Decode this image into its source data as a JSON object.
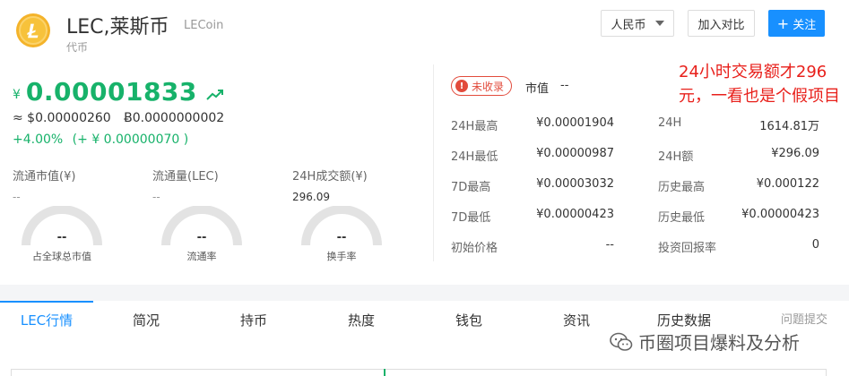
{
  "header": {
    "title": "LEC,莱斯币",
    "subtitle": "LECoin",
    "type": "代币",
    "logo_icon": "litecoin-logo-icon",
    "currency_select": "人民币",
    "compare_label": "加入对比",
    "follow_label": "关注",
    "follow_icon": "+"
  },
  "price": {
    "symbol": "¥",
    "value": "0.00001833",
    "usd": "≈ $0.00000260",
    "btc": "Ƀ0.0000000002",
    "change_pct": "+4.00%",
    "change_abs": "(+ ¥ 0.00000070 )"
  },
  "stats": [
    {
      "label": "流通市值(¥)",
      "value": "--"
    },
    {
      "label": "流通量(LEC)",
      "value": "--"
    },
    {
      "label": "24H成交额(¥)",
      "value": "296.09"
    }
  ],
  "gauges": [
    {
      "value": "--",
      "label": "占全球总市值",
      "fill": 0
    },
    {
      "value": "--",
      "label": "流通率",
      "fill": 0
    },
    {
      "value": "--",
      "label": "换手率",
      "fill": 0
    }
  ],
  "market": {
    "badge": "未收录",
    "badge_icon": "!",
    "mcap_label": "市值",
    "mcap_value": "--"
  },
  "details_left": [
    {
      "label": "24H最高",
      "value": "¥0.00001904"
    },
    {
      "label": "24H最低",
      "value": "¥0.00000987"
    },
    {
      "label": "7D最高",
      "value": "¥0.00003032"
    },
    {
      "label": "7D最低",
      "value": "¥0.00000423"
    },
    {
      "label": "初始价格",
      "value": "--"
    }
  ],
  "details_right": [
    {
      "label": "24H",
      "value": "1614.81万"
    },
    {
      "label": "24H额",
      "value": "¥296.09"
    },
    {
      "label": "历史最高",
      "value": "¥0.000122"
    },
    {
      "label": "历史最低",
      "value": "¥0.00000423"
    },
    {
      "label": "投资回报率",
      "value": "0"
    }
  ],
  "annotation": "24小时交易额才296元，一看也是个假项目",
  "tabs": [
    "LEC行情",
    "简况",
    "持币",
    "热度",
    "钱包",
    "资讯",
    "历史数据"
  ],
  "active_tab": 0,
  "feedback": "问题提交",
  "watermark": "币圈项目爆料及分析",
  "colors": {
    "up": "#17b26a",
    "primary": "#1890ff",
    "warn": "#e24b3c",
    "annotation": "#e8201b"
  }
}
